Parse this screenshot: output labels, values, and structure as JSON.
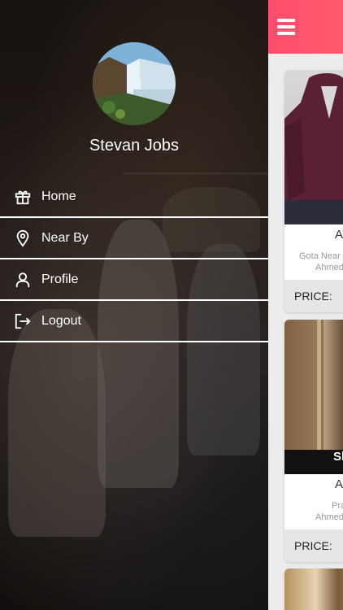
{
  "profile": {
    "name": "Stevan Jobs"
  },
  "menu": {
    "items": [
      {
        "label": "Home",
        "icon": "gift-icon"
      },
      {
        "label": "Near By",
        "icon": "location-pin-icon"
      },
      {
        "label": "Profile",
        "icon": "user-icon"
      },
      {
        "label": "Logout",
        "icon": "logout-icon"
      }
    ]
  },
  "topbar": {
    "menu_icon": "hamburger-icon",
    "color": "#ff4d6d"
  },
  "products": [
    {
      "title": "A",
      "sub1": "Gota Near",
      "sub2": "Ahmed",
      "price_label": "PRICE:"
    },
    {
      "title": "A",
      "overlay": "Sl",
      "sub1": "Pra",
      "sub2": "Ahmed",
      "price_label": "PRICE:"
    }
  ]
}
